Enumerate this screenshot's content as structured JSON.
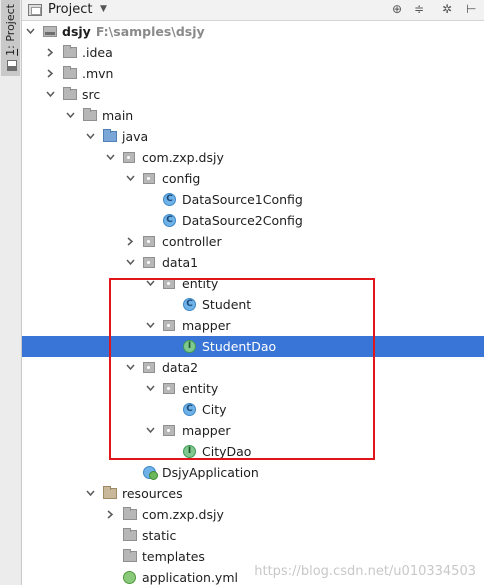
{
  "tool_window": {
    "tab_label_number": "1",
    "tab_label_text": ": Project"
  },
  "header": {
    "title": "Project",
    "tools": {
      "locate": "⊕",
      "collapse": "≑",
      "settings": "✲",
      "hide": "⊢"
    },
    "caret": "▼"
  },
  "tree": [
    {
      "label": "dsjy",
      "path": "F:\\samples\\dsjy",
      "icon": "project-folder-icon",
      "expanded": true,
      "level": 0
    },
    {
      "label": ".idea",
      "icon": "folder-icon",
      "expanded": false,
      "level": 1
    },
    {
      "label": ".mvn",
      "icon": "folder-icon",
      "expanded": false,
      "level": 1
    },
    {
      "label": "src",
      "icon": "folder-icon",
      "expanded": true,
      "level": 1
    },
    {
      "label": "main",
      "icon": "folder-icon",
      "expanded": true,
      "level": 2
    },
    {
      "label": "java",
      "icon": "source-folder-icon",
      "expanded": true,
      "level": 3
    },
    {
      "label": "com.zxp.dsjy",
      "icon": "package-icon",
      "expanded": true,
      "level": 4
    },
    {
      "label": "config",
      "icon": "package-icon",
      "expanded": true,
      "level": 5
    },
    {
      "label": "DataSource1Config",
      "icon": "class-icon",
      "level": 6
    },
    {
      "label": "DataSource2Config",
      "icon": "class-icon",
      "level": 6
    },
    {
      "label": "controller",
      "icon": "package-icon",
      "expanded": false,
      "level": 5
    },
    {
      "label": "data1",
      "icon": "package-icon",
      "expanded": true,
      "level": 5
    },
    {
      "label": "entity",
      "icon": "package-icon",
      "expanded": true,
      "level": 6
    },
    {
      "label": "Student",
      "icon": "class-icon",
      "level": 7
    },
    {
      "label": "mapper",
      "icon": "package-icon",
      "expanded": true,
      "level": 6
    },
    {
      "label": "StudentDao",
      "icon": "interface-icon",
      "level": 7,
      "selected": true
    },
    {
      "label": "data2",
      "icon": "package-icon",
      "expanded": true,
      "level": 5
    },
    {
      "label": "entity",
      "icon": "package-icon",
      "expanded": true,
      "level": 6
    },
    {
      "label": "City",
      "icon": "class-icon",
      "level": 7
    },
    {
      "label": "mapper",
      "icon": "package-icon",
      "expanded": true,
      "level": 6
    },
    {
      "label": "CityDao",
      "icon": "interface-icon",
      "level": 7
    },
    {
      "label": "DsjyApplication",
      "icon": "spring-boot-class-icon",
      "level": 5
    },
    {
      "label": "resources",
      "icon": "resources-folder-icon",
      "expanded": true,
      "level": 3
    },
    {
      "label": "com.zxp.dsjy",
      "icon": "folder-icon",
      "expanded": false,
      "level": 4
    },
    {
      "label": "static",
      "icon": "folder-icon",
      "level": 4
    },
    {
      "label": "templates",
      "icon": "folder-icon",
      "level": 4
    },
    {
      "label": "application.yml",
      "icon": "yml-file-icon",
      "level": 4
    }
  ],
  "class_glyph": "C",
  "interface_glyph": "I",
  "watermark": "https://blog.csdn.net/u010334503"
}
